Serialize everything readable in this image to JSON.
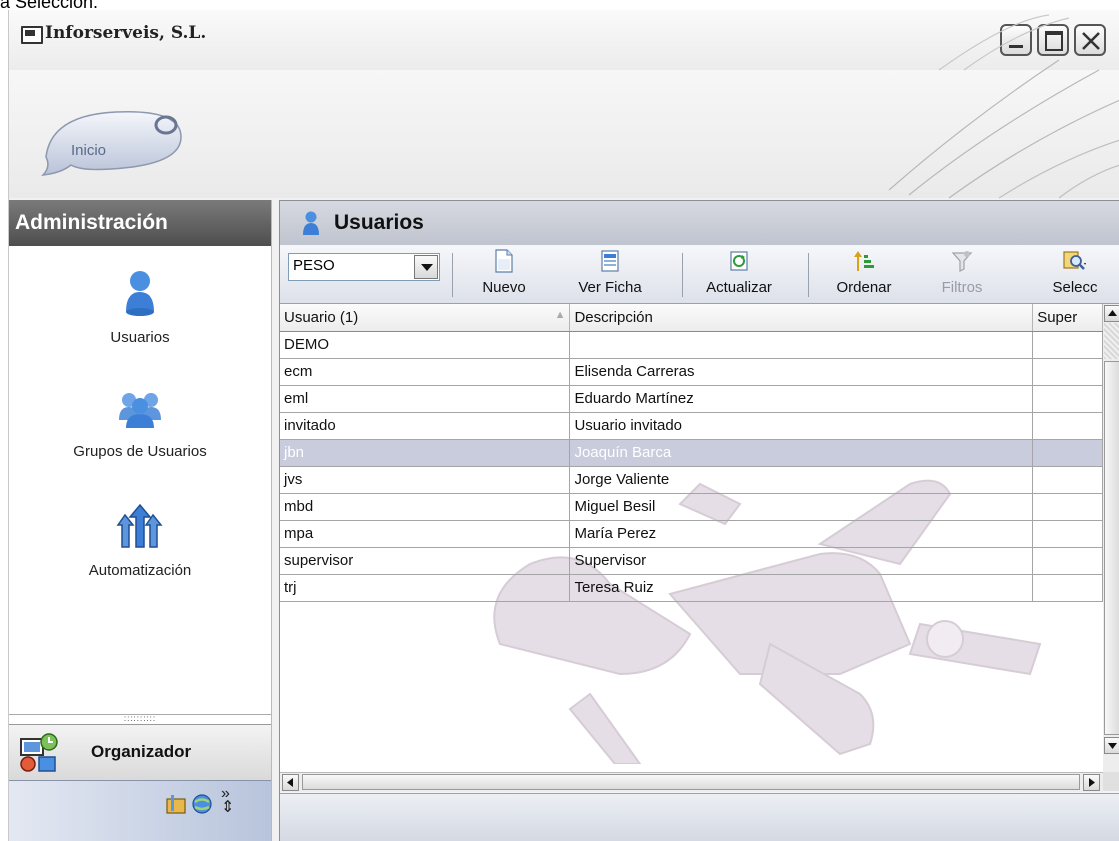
{
  "caption": "a Selección.",
  "window": {
    "title": "Inforserveis, S.L.",
    "inicio": "Inicio"
  },
  "sidebar": {
    "header": "Administración",
    "items": [
      {
        "label": "Usuarios",
        "icon": "user-icon"
      },
      {
        "label": "Grupos de Usuarios",
        "icon": "user-group-icon"
      },
      {
        "label": "Automatización",
        "icon": "automation-arrows-icon"
      }
    ],
    "organizer": "Organizador"
  },
  "panel": {
    "title": "Usuarios",
    "combo_value": "PESO",
    "toolbar": {
      "nuevo": "Nuevo",
      "ver_ficha": "Ver Ficha",
      "actualizar": "Actualizar",
      "ordenar": "Ordenar",
      "filtros": "Filtros",
      "seleccion": "Selecc"
    },
    "columns": [
      "Usuario (1)",
      "Descripción",
      "Super"
    ],
    "rows": [
      {
        "usuario": "DEMO",
        "descripcion": ""
      },
      {
        "usuario": "ecm",
        "descripcion": "Elisenda Carreras"
      },
      {
        "usuario": "eml",
        "descripcion": "Eduardo Martínez"
      },
      {
        "usuario": "invitado",
        "descripcion": "Usuario invitado"
      },
      {
        "usuario": "jbn",
        "descripcion": "Joaquín Barca",
        "selected": true
      },
      {
        "usuario": "jvs",
        "descripcion": "Jorge Valiente"
      },
      {
        "usuario": "mbd",
        "descripcion": "Miguel Besil"
      },
      {
        "usuario": "mpa",
        "descripcion": "María Perez"
      },
      {
        "usuario": "supervisor",
        "descripcion": "Supervisor"
      },
      {
        "usuario": "trj",
        "descripcion": "Teresa Ruiz"
      }
    ]
  },
  "colors": {
    "selected_row": "#c8ccdc",
    "sidebar_header": "#5e5e5e",
    "accent_blue": "#3d7fd6"
  }
}
